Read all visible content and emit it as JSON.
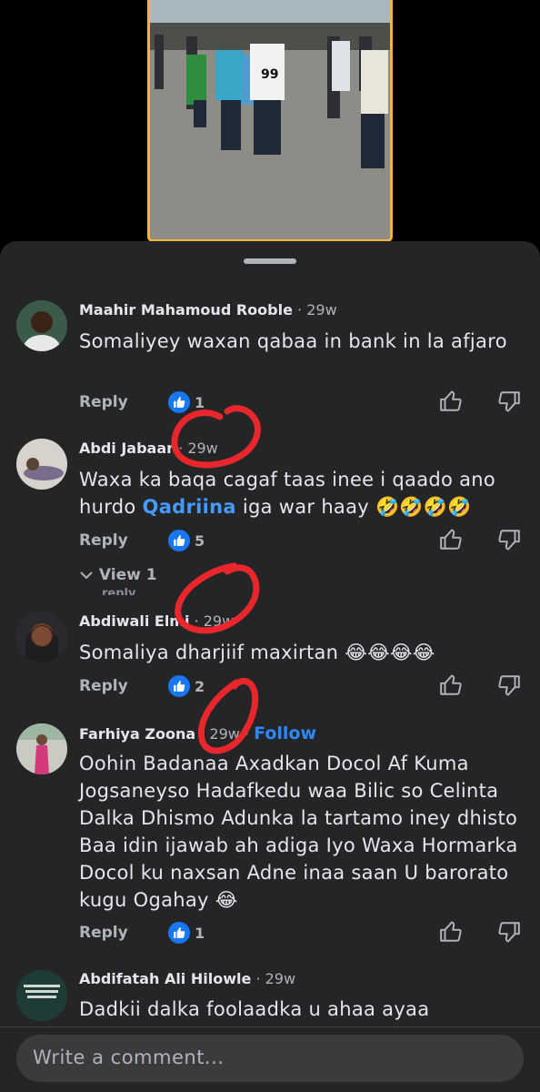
{
  "colors": {
    "sheet": "#242526",
    "accent": "#1877f2",
    "follow": "#2d88ff",
    "mention": "#4599ff",
    "annotation": "#e8262b",
    "video_border": "#f4b43a"
  },
  "video": {
    "jersey_text": "99"
  },
  "comments": [
    {
      "name": "Maahir Mahamoud Rooble",
      "dot": "·",
      "time": "29w",
      "text": "Somaliyey waxan qabaa in bank in la afjaro",
      "reply": "Reply",
      "likes": "1"
    },
    {
      "name": "Abdi Jabaar",
      "dot": "·",
      "time": "29w",
      "text_before": "Waxa ka baqa cagaf taas inee i qaado ano hurdo ",
      "mention": "Qadriina",
      "text_after": " iga war haay ",
      "emoji": "🤣🤣🤣🤣",
      "reply": "Reply",
      "likes": "5",
      "view_replies": "View 1",
      "view_replies_2": "reply"
    },
    {
      "name": "Abdiwali Elmi",
      "dot": "·",
      "time": "29w",
      "text": "Somaliya dharjiif maxirtan ",
      "emoji": "😂😂😂😂",
      "reply": "Reply",
      "likes": "2"
    },
    {
      "name": "Farhiya Zoona",
      "dot": "·",
      "time": "29w",
      "dot2": "·",
      "follow": "Follow",
      "text": "Oohin Badanaa Axadkan Docol Af Kuma Jogsaneyso Hadafkedu waa Bilic so Celinta Dalka Dhismo Adunka la tartamo iney dhisto Baa idin ijawab ah adiga Iyo Waxa Hormarka Docol ku naxsan Adne inaa saan U barorato kugu Ogahay ",
      "emoji": "😂",
      "reply": "Reply",
      "likes": "1"
    },
    {
      "name": "Abdifatah Ali Hilowle",
      "dot": "·",
      "time": "29w",
      "text": "Dadkii dalka foolaadka u ahaa ayaa"
    }
  ],
  "composer": {
    "placeholder": "Write a comment..."
  }
}
